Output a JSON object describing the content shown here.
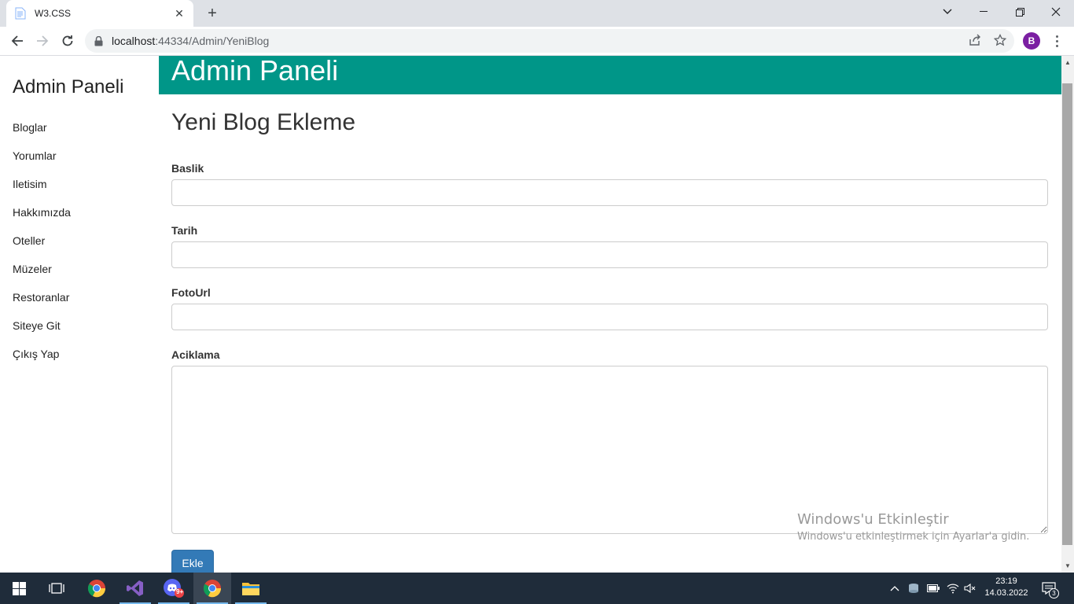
{
  "browser": {
    "tab_title": "W3.CSS",
    "url_host": "localhost",
    "url_rest": ":44334/Admin/YeniBlog",
    "profile_initial": "B"
  },
  "sidebar": {
    "title": "Admin Paneli",
    "items": [
      {
        "label": "Bloglar"
      },
      {
        "label": "Yorumlar"
      },
      {
        "label": "Iletisim"
      },
      {
        "label": "Hakkımızda"
      },
      {
        "label": "Oteller"
      },
      {
        "label": "Müzeler"
      },
      {
        "label": "Restoranlar"
      },
      {
        "label": "Siteye Git"
      },
      {
        "label": "Çıkış Yap"
      }
    ]
  },
  "header": {
    "title": "Admin Paneli"
  },
  "form": {
    "page_title": "Yeni Blog Ekleme",
    "baslik_label": "Baslik",
    "baslik_value": "",
    "tarih_label": "Tarih",
    "tarih_value": "",
    "fotourl_label": "FotoUrl",
    "fotourl_value": "",
    "aciklama_label": "Aciklama",
    "aciklama_value": "",
    "submit_label": "Ekle"
  },
  "watermark": {
    "line1": "Windows'u Etkinleştir",
    "line2": "Windows'u etkinleştirmek için Ayarlar'a gidin."
  },
  "taskbar": {
    "time": "23:19",
    "date": "14.03.2022",
    "notification_count": "3",
    "discord_badge": "9+"
  },
  "colors": {
    "header_bg": "#009688",
    "button_bg": "#337ab7",
    "taskbar_bg": "#1f2c3a"
  }
}
